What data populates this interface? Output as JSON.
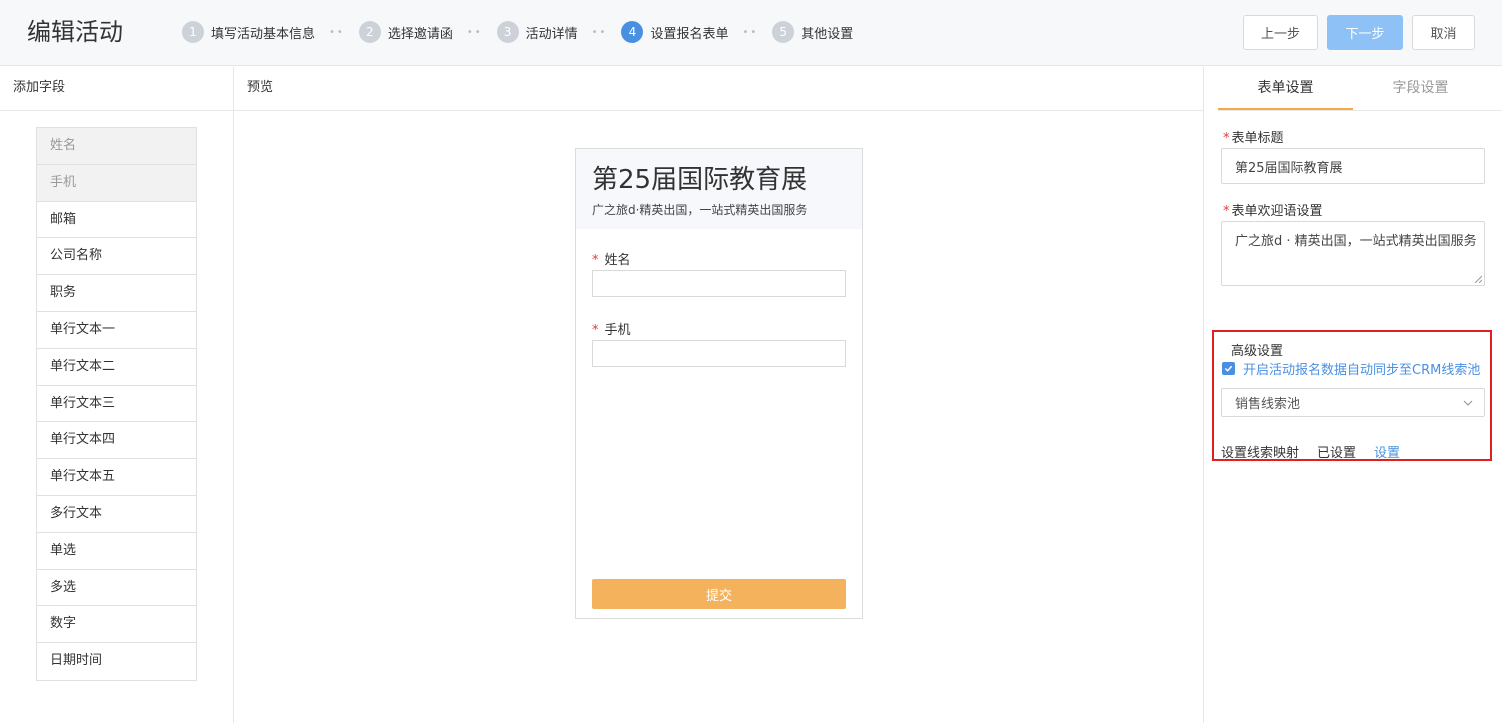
{
  "header": {
    "title": "编辑活动",
    "steps": [
      {
        "num": "1",
        "label": "填写活动基本信息"
      },
      {
        "num": "2",
        "label": "选择邀请函"
      },
      {
        "num": "3",
        "label": "活动详情"
      },
      {
        "num": "4",
        "label": "设置报名表单"
      },
      {
        "num": "5",
        "label": "其他设置"
      }
    ],
    "active_step": 4,
    "prev_label": "上一步",
    "next_label": "下一步",
    "cancel_label": "取消"
  },
  "left": {
    "title": "添加字段",
    "fields": [
      {
        "label": "姓名",
        "used": true
      },
      {
        "label": "手机",
        "used": true
      },
      {
        "label": "邮箱",
        "used": false
      },
      {
        "label": "公司名称",
        "used": false
      },
      {
        "label": "职务",
        "used": false
      },
      {
        "label": "单行文本一",
        "used": false
      },
      {
        "label": "单行文本二",
        "used": false
      },
      {
        "label": "单行文本三",
        "used": false
      },
      {
        "label": "单行文本四",
        "used": false
      },
      {
        "label": "单行文本五",
        "used": false
      },
      {
        "label": "多行文本",
        "used": false
      },
      {
        "label": "单选",
        "used": false
      },
      {
        "label": "多选",
        "used": false
      },
      {
        "label": "数字",
        "used": false
      },
      {
        "label": "日期时间",
        "used": false
      }
    ]
  },
  "preview": {
    "title": "预览",
    "form_title": "第25届国际教育展",
    "welcome": "广之旅d·精英出国，一站式精英出国服务",
    "required_mark": "*",
    "field1": "姓名",
    "field2": "手机",
    "submit_label": "提交"
  },
  "right": {
    "tab_form": "表单设置",
    "tab_field": "字段设置",
    "required_mark": "*",
    "form_title_label": "表单标题",
    "form_title_value": "第25届国际教育展",
    "welcome_label": "表单欢迎语设置",
    "welcome_value": "广之旅d · 精英出国，一站式精英出国服务",
    "advanced": {
      "title": "高级设置",
      "sync_label": "开启活动报名数据自动同步至CRM线索池",
      "sync_checked": true,
      "pool_value": "销售线索池",
      "mapping_label": "设置线索映射",
      "mapping_status": "已设置",
      "mapping_link": "设置"
    }
  },
  "colors": {
    "accent": "#4a90e2",
    "submit": "#f5b25d",
    "tab_underline": "#f5a94a",
    "highlight_box": "#e02020"
  }
}
